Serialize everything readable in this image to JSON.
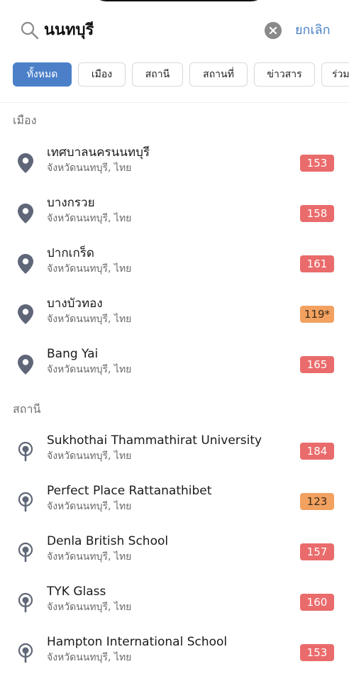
{
  "search": {
    "query": "นนทบุรี",
    "cancel_label": "ยกเลิก"
  },
  "filters": [
    "ทั้งหมด",
    "เมือง",
    "สถานี",
    "สถานที่",
    "ข่าวสาร",
    "ร่วม"
  ],
  "colors": {
    "accent": "#4b80c9",
    "aqi_red": "#ea6b6b",
    "aqi_orange": "#f2a160",
    "pin": "#5f6678"
  },
  "cities_section": {
    "header": "เมือง",
    "items": [
      {
        "name": "เทศบาลนครนนทบุรี",
        "region": "จังหวัดนนทบุรี, ไทย",
        "aqi": "153",
        "level": "red"
      },
      {
        "name": "บางกรวย",
        "region": "จังหวัดนนทบุรี, ไทย",
        "aqi": "158",
        "level": "red"
      },
      {
        "name": "ปากเกร็ด",
        "region": "จังหวัดนนทบุรี, ไทย",
        "aqi": "161",
        "level": "red"
      },
      {
        "name": "บางบัวทอง",
        "region": "จังหวัดนนทบุรี, ไทย",
        "aqi": "119*",
        "level": "orange"
      },
      {
        "name": "Bang Yai",
        "region": "จังหวัดนนทบุรี, ไทย",
        "aqi": "165",
        "level": "red"
      }
    ]
  },
  "stations_section": {
    "header": "สถานี",
    "items": [
      {
        "name": "Sukhothai Thammathirat University",
        "region": "จังหวัดนนทบุรี, ไทย",
        "aqi": "184",
        "level": "red"
      },
      {
        "name": "Perfect Place Rattanathibet",
        "region": "จังหวัดนนทบุรี, ไทย",
        "aqi": "123",
        "level": "orange"
      },
      {
        "name": "Denla British School",
        "region": "จังหวัดนนทบุรี, ไทย",
        "aqi": "157",
        "level": "red"
      },
      {
        "name": "TYK Glass",
        "region": "จังหวัดนนทบุรี, ไทย",
        "aqi": "160",
        "level": "red"
      },
      {
        "name": "Hampton International School",
        "region": "จังหวัดนนทบุรี, ไทย",
        "aqi": "153",
        "level": "red"
      }
    ]
  }
}
